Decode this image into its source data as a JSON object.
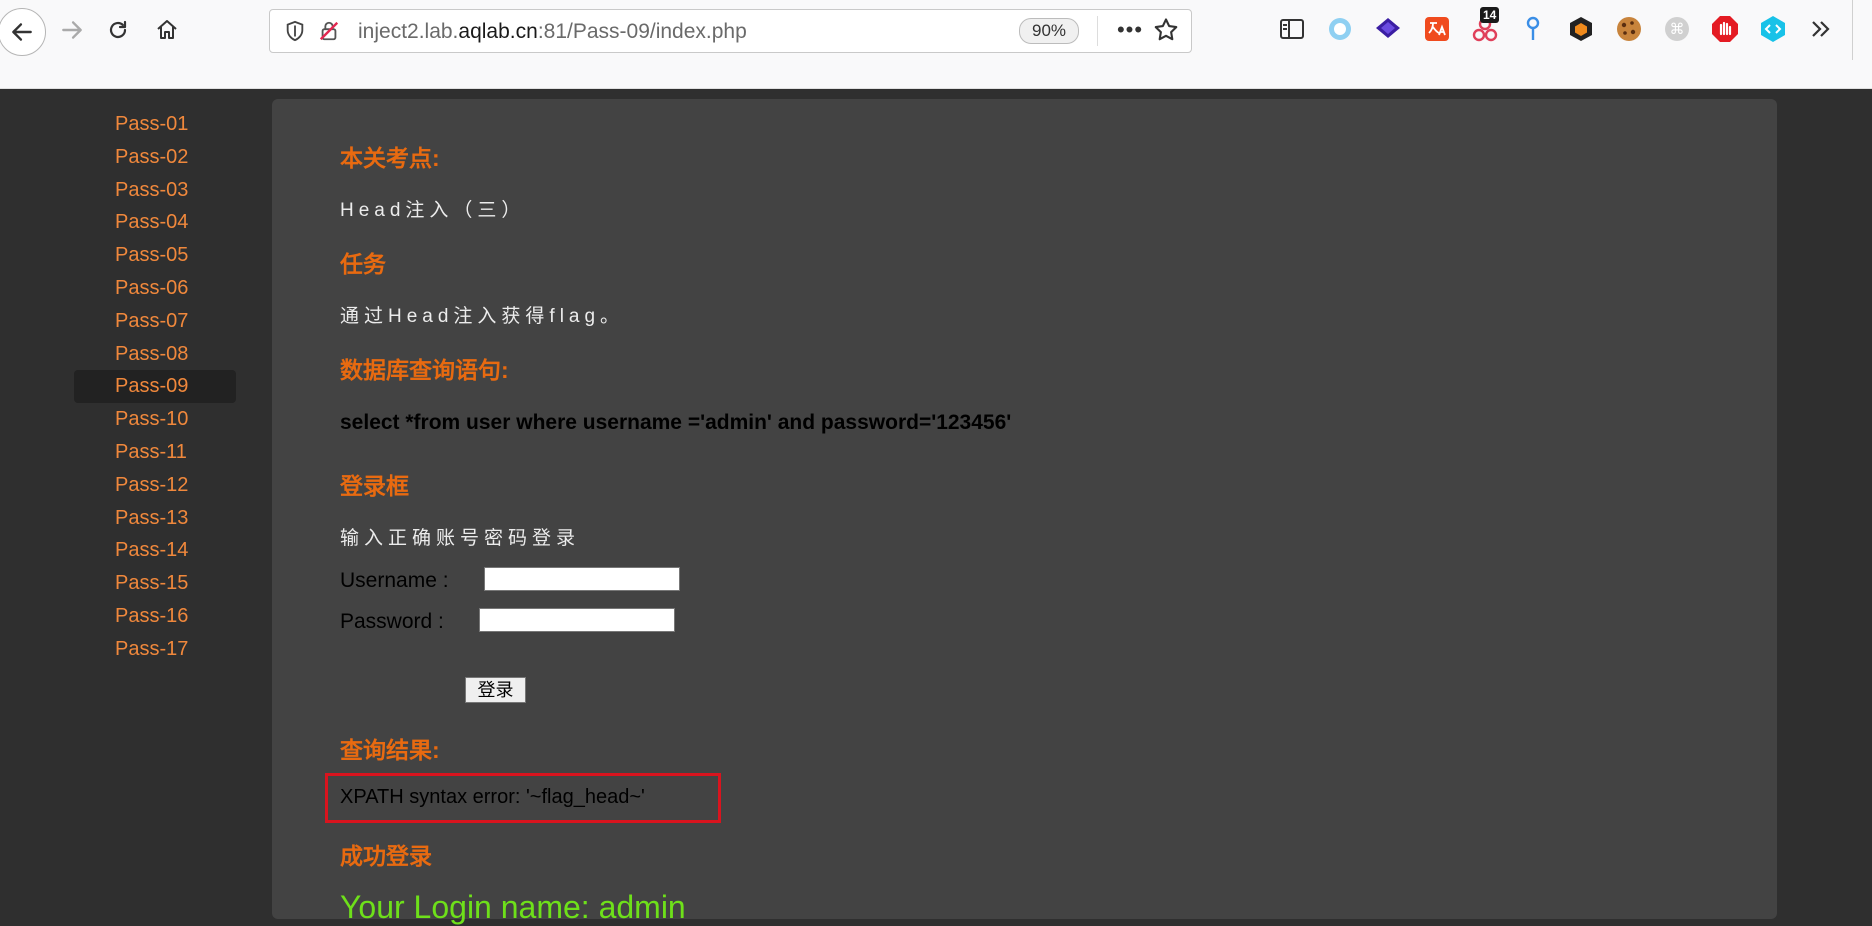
{
  "browser": {
    "url_prefix": "inject2.lab.",
    "url_host_strong": "aqlab.cn",
    "url_suffix": ":81/Pass-09/index.php",
    "zoom": "90%",
    "more_label": "•••",
    "ext_badge": "14"
  },
  "sidebar": {
    "items": [
      "Pass-01",
      "Pass-02",
      "Pass-03",
      "Pass-04",
      "Pass-05",
      "Pass-06",
      "Pass-07",
      "Pass-08",
      "Pass-09",
      "Pass-10",
      "Pass-11",
      "Pass-12",
      "Pass-13",
      "Pass-14",
      "Pass-15",
      "Pass-16",
      "Pass-17"
    ],
    "active": "Pass-09"
  },
  "main": {
    "topic_heading": "本关考点:",
    "topic_text": "Head注入（三）",
    "task_heading": "任务",
    "task_text": "通过Head注入获得flag。",
    "query_heading": "数据库查询语句:",
    "query_text": "select *from user where username ='admin' and password='123456'",
    "login_heading": "登录框",
    "login_hint": "输入正确账号密码登录",
    "username_label": "Username :",
    "password_label": "Password :",
    "login_button": "登录",
    "result_heading": "查询结果:",
    "result_text": "XPATH syntax error: '~flag_head~'",
    "success_heading": "成功登录",
    "welcome_text": "Your Login name: admin"
  },
  "colors": {
    "accent_orange": "#e86a10",
    "link_orange": "#f0883c",
    "highlight_red": "#d9141e",
    "welcome_green": "#6ee01a"
  }
}
